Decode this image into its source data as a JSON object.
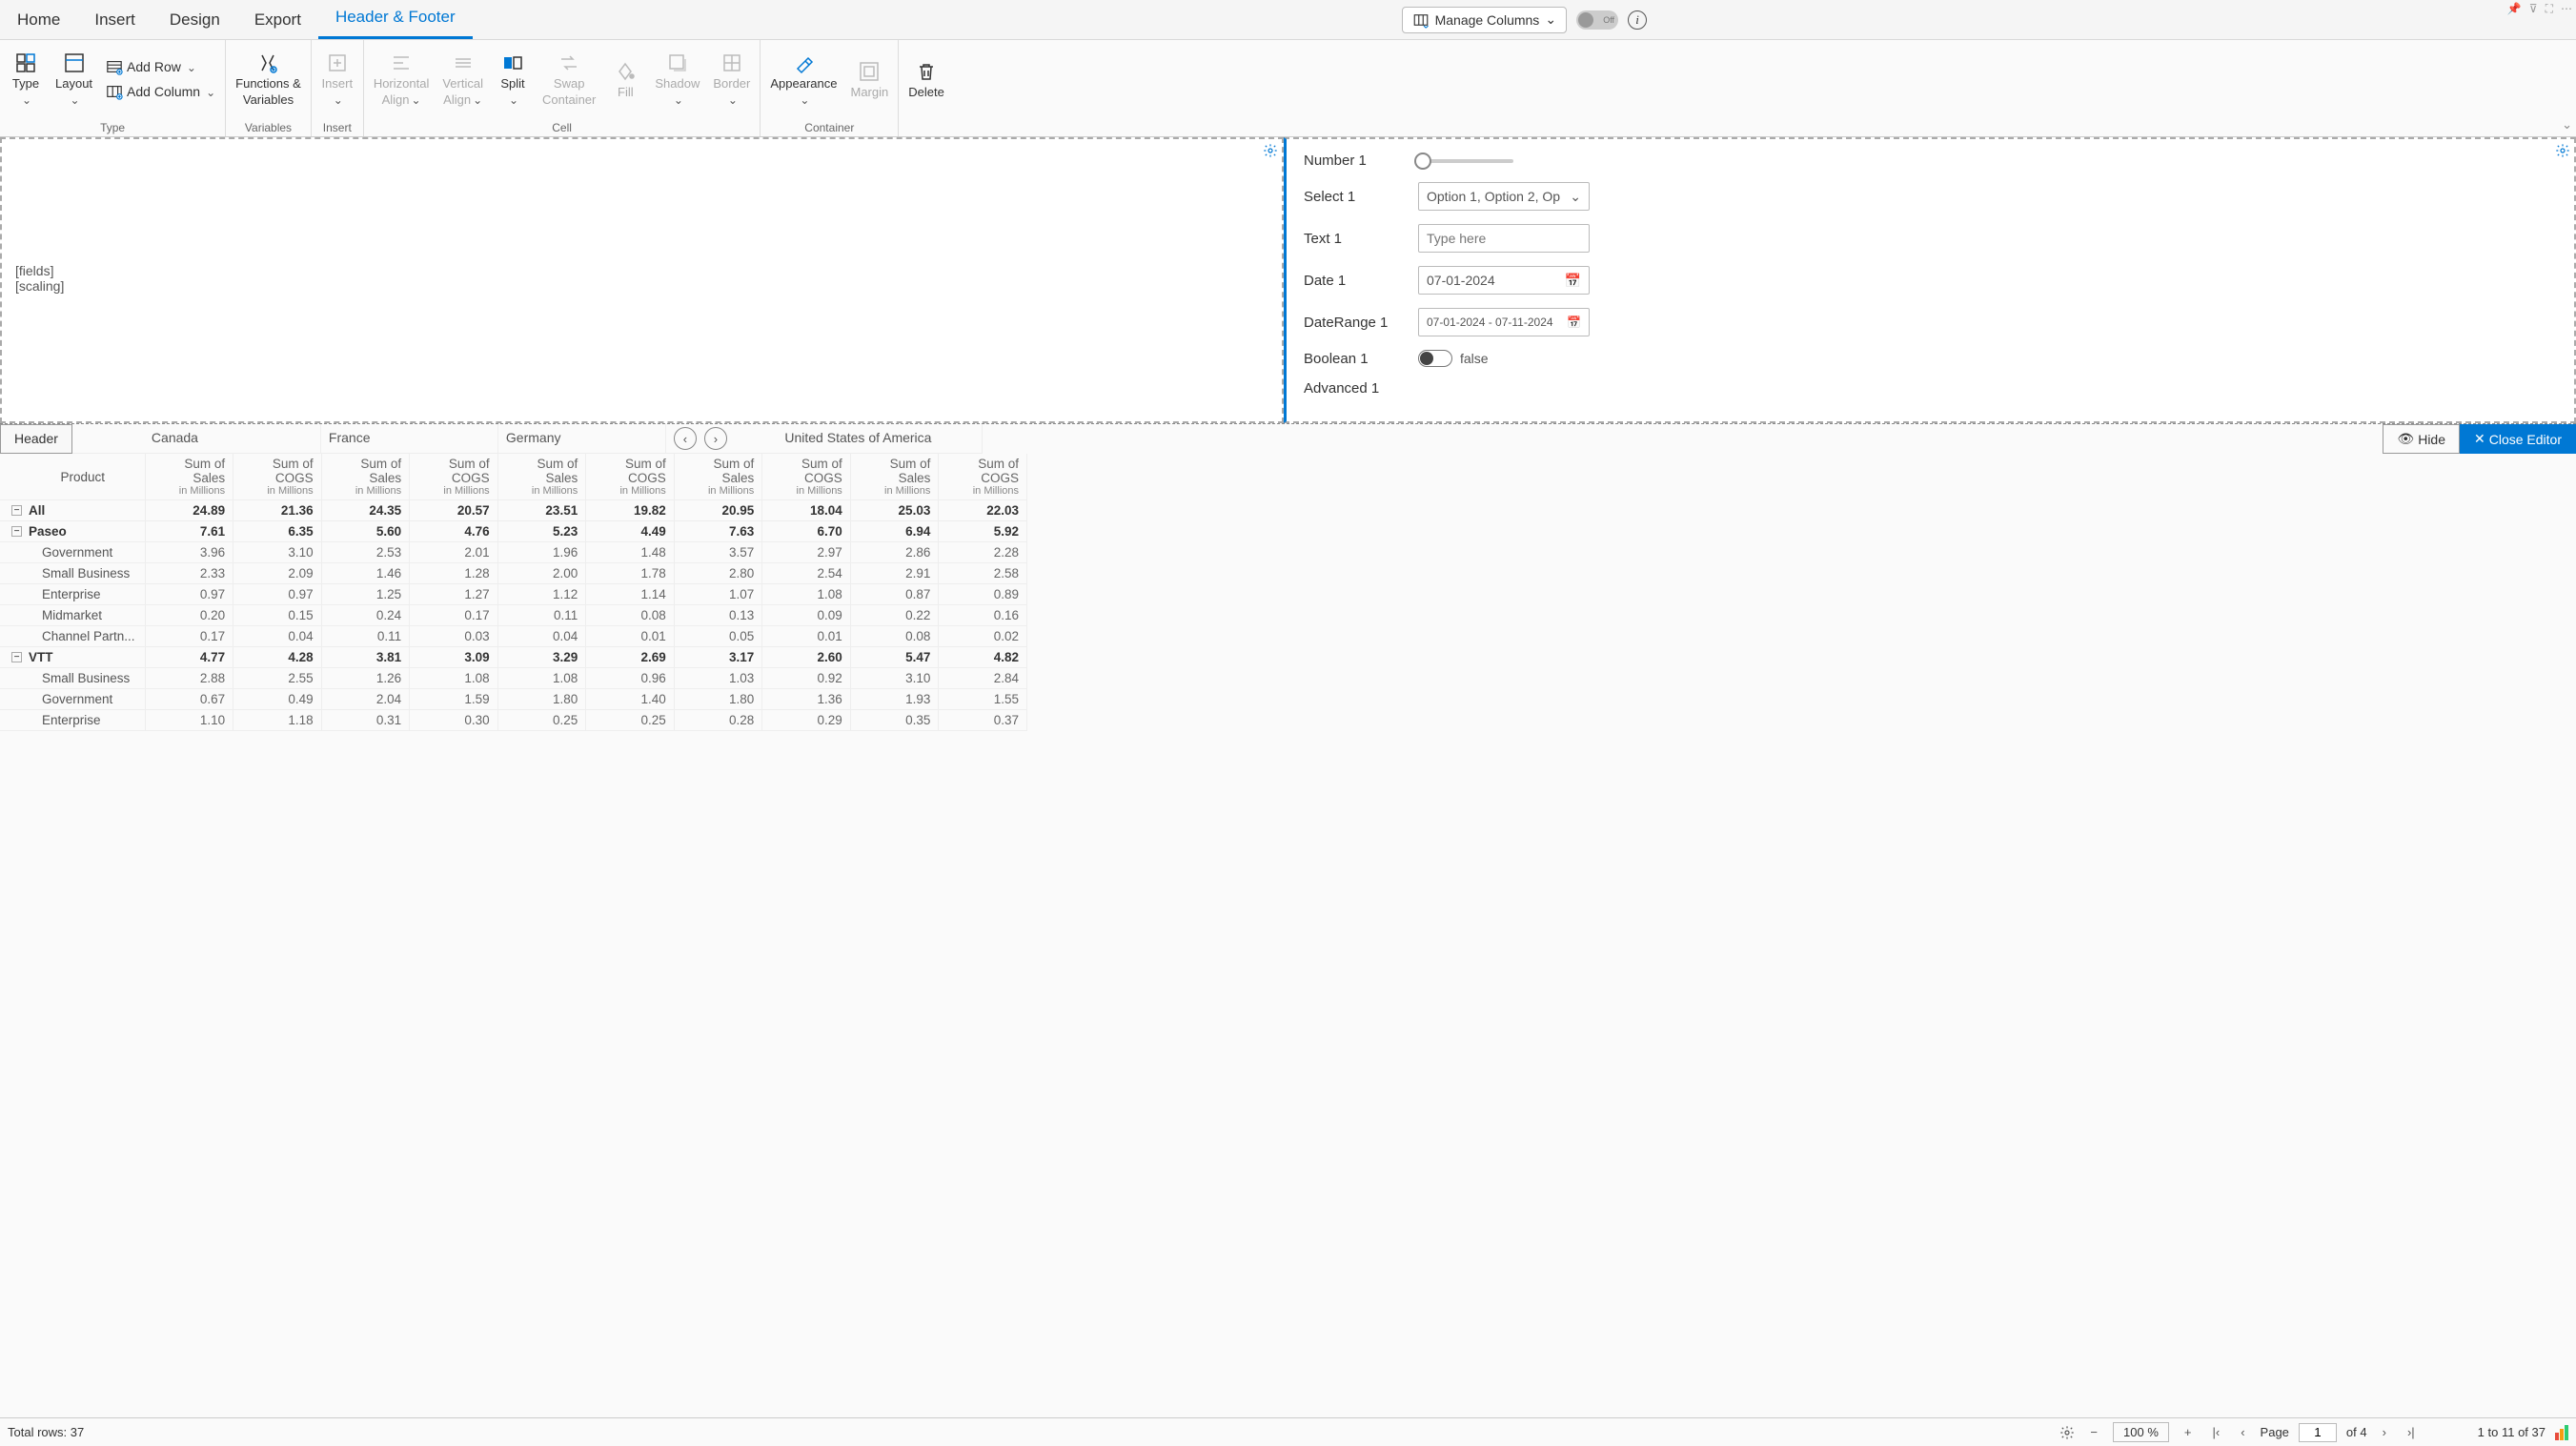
{
  "tabs": {
    "home": "Home",
    "insert": "Insert",
    "design": "Design",
    "export": "Export",
    "headerfooter": "Header & Footer"
  },
  "topbar": {
    "manage_columns": "Manage Columns",
    "off_label": "Off"
  },
  "ribbon": {
    "type": "Type",
    "layout": "Layout",
    "add_row": "Add Row",
    "add_column": "Add Column",
    "type_group": "Type",
    "functions": "Functions &",
    "variables": "Variables",
    "variables_group": "Variables",
    "insert": "Insert",
    "insert_group": "Insert",
    "halign": "Horizontal",
    "align": "Align",
    "valign": "Vertical",
    "split": "Split",
    "swap": "Swap",
    "container": "Container",
    "fill": "Fill",
    "shadow": "Shadow",
    "border": "Border",
    "cell_group": "Cell",
    "appearance": "Appearance",
    "margin": "Margin",
    "container_group": "Container",
    "delete": "Delete"
  },
  "header_left": {
    "fields": "[fields]",
    "scaling": "[scaling]"
  },
  "params": {
    "number_label": "Number 1",
    "select_label": "Select 1",
    "select_value": "Option 1, Option 2, Op",
    "text_label": "Text 1",
    "text_placeholder": "Type here",
    "date_label": "Date 1",
    "date_value": "07-01-2024",
    "daterange_label": "DateRange 1",
    "daterange_value": "07-01-2024 - 07-11-2024",
    "bool_label": "Boolean 1",
    "bool_value": "false",
    "advanced_label": "Advanced 1"
  },
  "toolbar": {
    "header_btn": "Header",
    "hide": "Hide",
    "close": "Close Editor"
  },
  "countries": {
    "canada": "Canada",
    "france": "France",
    "germany": "Germany",
    "usa": "United States of America"
  },
  "headers": {
    "product": "Product",
    "sum_sales": "Sum of Sales",
    "sum_cogs": "Sum of COGS",
    "in_millions": "in Millions"
  },
  "rows": [
    {
      "name": "All",
      "bold": true,
      "lvl": 0,
      "exp": "−",
      "v": [
        "24.89",
        "21.36",
        "24.35",
        "20.57",
        "23.51",
        "19.82",
        "20.95",
        "18.04",
        "25.03",
        "22.03"
      ]
    },
    {
      "name": "Paseo",
      "bold": true,
      "lvl": 0,
      "exp": "−",
      "v": [
        "7.61",
        "6.35",
        "5.60",
        "4.76",
        "5.23",
        "4.49",
        "7.63",
        "6.70",
        "6.94",
        "5.92"
      ]
    },
    {
      "name": "Government",
      "bold": false,
      "lvl": 1,
      "v": [
        "3.96",
        "3.10",
        "2.53",
        "2.01",
        "1.96",
        "1.48",
        "3.57",
        "2.97",
        "2.86",
        "2.28"
      ]
    },
    {
      "name": "Small Business",
      "bold": false,
      "lvl": 1,
      "v": [
        "2.33",
        "2.09",
        "1.46",
        "1.28",
        "2.00",
        "1.78",
        "2.80",
        "2.54",
        "2.91",
        "2.58"
      ]
    },
    {
      "name": "Enterprise",
      "bold": false,
      "lvl": 1,
      "v": [
        "0.97",
        "0.97",
        "1.25",
        "1.27",
        "1.12",
        "1.14",
        "1.07",
        "1.08",
        "0.87",
        "0.89"
      ]
    },
    {
      "name": "Midmarket",
      "bold": false,
      "lvl": 1,
      "v": [
        "0.20",
        "0.15",
        "0.24",
        "0.17",
        "0.11",
        "0.08",
        "0.13",
        "0.09",
        "0.22",
        "0.16"
      ]
    },
    {
      "name": "Channel Partn...",
      "bold": false,
      "lvl": 1,
      "v": [
        "0.17",
        "0.04",
        "0.11",
        "0.03",
        "0.04",
        "0.01",
        "0.05",
        "0.01",
        "0.08",
        "0.02"
      ]
    },
    {
      "name": "VTT",
      "bold": true,
      "lvl": 0,
      "exp": "−",
      "v": [
        "4.77",
        "4.28",
        "3.81",
        "3.09",
        "3.29",
        "2.69",
        "3.17",
        "2.60",
        "5.47",
        "4.82"
      ]
    },
    {
      "name": "Small Business",
      "bold": false,
      "lvl": 1,
      "v": [
        "2.88",
        "2.55",
        "1.26",
        "1.08",
        "1.08",
        "0.96",
        "1.03",
        "0.92",
        "3.10",
        "2.84"
      ]
    },
    {
      "name": "Government",
      "bold": false,
      "lvl": 1,
      "v": [
        "0.67",
        "0.49",
        "2.04",
        "1.59",
        "1.80",
        "1.40",
        "1.80",
        "1.36",
        "1.93",
        "1.55"
      ]
    },
    {
      "name": "Enterprise",
      "bold": false,
      "lvl": 1,
      "v": [
        "1.10",
        "1.18",
        "0.31",
        "0.30",
        "0.25",
        "0.25",
        "0.28",
        "0.29",
        "0.35",
        "0.37"
      ]
    }
  ],
  "status": {
    "total_rows": "Total rows: 37",
    "zoom": "100 %",
    "page_label": "Page",
    "page_current": "1",
    "page_of": "of 4",
    "range": "1 to 11 of 37"
  }
}
